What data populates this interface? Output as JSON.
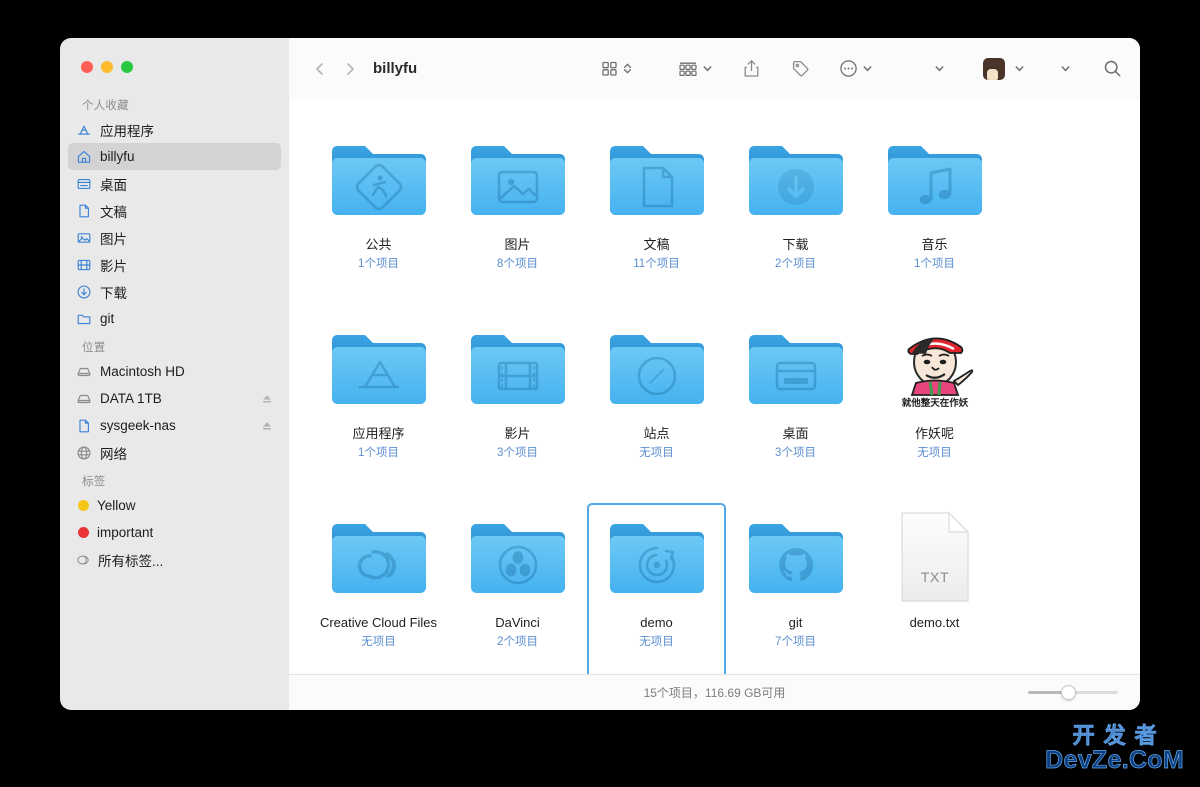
{
  "window": {
    "title": "billyfu",
    "traffic_lights": [
      {
        "name": "close",
        "color": "#ff5f57"
      },
      {
        "name": "minimize",
        "color": "#febc2e"
      },
      {
        "name": "maximize",
        "color": "#28c840"
      }
    ]
  },
  "toolbar": {
    "back_icon": "chevron-left-icon",
    "forward_icon": "chevron-right-icon",
    "view_icon": "grid-view-icon",
    "view_chevron_icon": "updown-chevron-icon",
    "group_icon": "group-by-icon",
    "group_chevron_icon": "chevron-down-icon",
    "share_icon": "share-icon",
    "tag_icon": "tag-icon",
    "more_icon": "ellipsis-circle-icon",
    "more_chevron_icon": "chevron-down-icon",
    "extra_chevron_icon": "chevron-down-icon",
    "avatar_icon": "user-avatar",
    "avatar_chevron_icon": "chevron-down-icon",
    "trailing_chevron_icon": "chevron-down-icon",
    "search_icon": "search-icon"
  },
  "sidebar": {
    "groups": [
      {
        "title": "个人收藏",
        "items": [
          {
            "label": "应用程序",
            "icon": "appstore-icon",
            "selected": false,
            "eject": false
          },
          {
            "label": "billyfu",
            "icon": "home-icon",
            "selected": true,
            "eject": false
          },
          {
            "label": "桌面",
            "icon": "desktop-icon",
            "selected": false,
            "eject": false
          },
          {
            "label": "文稿",
            "icon": "document-icon",
            "selected": false,
            "eject": false
          },
          {
            "label": "图片",
            "icon": "photos-icon",
            "selected": false,
            "eject": false
          },
          {
            "label": "影片",
            "icon": "movies-icon",
            "selected": false,
            "eject": false
          },
          {
            "label": "下载",
            "icon": "downloads-icon",
            "selected": false,
            "eject": false
          },
          {
            "label": "git",
            "icon": "folder-icon",
            "selected": false,
            "eject": false
          }
        ]
      },
      {
        "title": "位置",
        "items": [
          {
            "label": "Macintosh HD",
            "icon": "harddisk-icon",
            "selected": false,
            "eject": false
          },
          {
            "label": "DATA 1TB",
            "icon": "harddisk-icon",
            "selected": false,
            "eject": true
          },
          {
            "label": "sysgeek-nas",
            "icon": "document-icon",
            "selected": false,
            "eject": true
          },
          {
            "label": "网络",
            "icon": "globe-icon",
            "selected": false,
            "eject": false
          }
        ]
      },
      {
        "title": "标签",
        "items": [
          {
            "label": "Yellow",
            "icon": "tag-dot",
            "color": "#f5c518",
            "selected": false,
            "eject": false
          },
          {
            "label": "important",
            "icon": "tag-dot",
            "color": "#e8343a",
            "selected": false,
            "eject": false
          },
          {
            "label": "所有标签...",
            "icon": "all-tags-icon",
            "selected": false,
            "eject": false
          }
        ]
      }
    ]
  },
  "files": [
    {
      "name": "公共",
      "count": "1个项目",
      "icon": "folder-public",
      "selected": false
    },
    {
      "name": "图片",
      "count": "8个项目",
      "icon": "folder-pictures",
      "selected": false
    },
    {
      "name": "文稿",
      "count": "11个项目",
      "icon": "folder-documents",
      "selected": false
    },
    {
      "name": "下载",
      "count": "2个项目",
      "icon": "folder-downloads",
      "selected": false
    },
    {
      "name": "音乐",
      "count": "1个项目",
      "icon": "folder-music",
      "selected": false
    },
    {
      "name": "应用程序",
      "count": "1个项目",
      "icon": "folder-apps",
      "selected": false
    },
    {
      "name": "影片",
      "count": "3个项目",
      "icon": "folder-movies",
      "selected": false
    },
    {
      "name": "站点",
      "count": "无项目",
      "icon": "folder-sites",
      "selected": false
    },
    {
      "name": "桌面",
      "count": "3个项目",
      "icon": "folder-desktop",
      "selected": false
    },
    {
      "name": "作妖呢",
      "count": "无项目",
      "icon": "custom-meme",
      "selected": false,
      "meme_text": "就他整天在作妖"
    },
    {
      "name": "Creative Cloud Files",
      "count": "无项目",
      "icon": "folder-creativecloud",
      "selected": false
    },
    {
      "name": "DaVinci",
      "count": "2个项目",
      "icon": "folder-davinci",
      "selected": false
    },
    {
      "name": "demo",
      "count": "无项目",
      "icon": "folder-demo",
      "selected": true
    },
    {
      "name": "git",
      "count": "7个项目",
      "icon": "folder-github",
      "selected": false
    },
    {
      "name": "demo.txt",
      "count": "",
      "icon": "file-txt",
      "selected": false,
      "file_label": "TXT"
    }
  ],
  "status": {
    "text": "15个项目，116.69 GB可用",
    "slider_name": "icon-size-slider"
  },
  "watermark": {
    "cn": "开发者",
    "en": "DevZe.CoM"
  }
}
